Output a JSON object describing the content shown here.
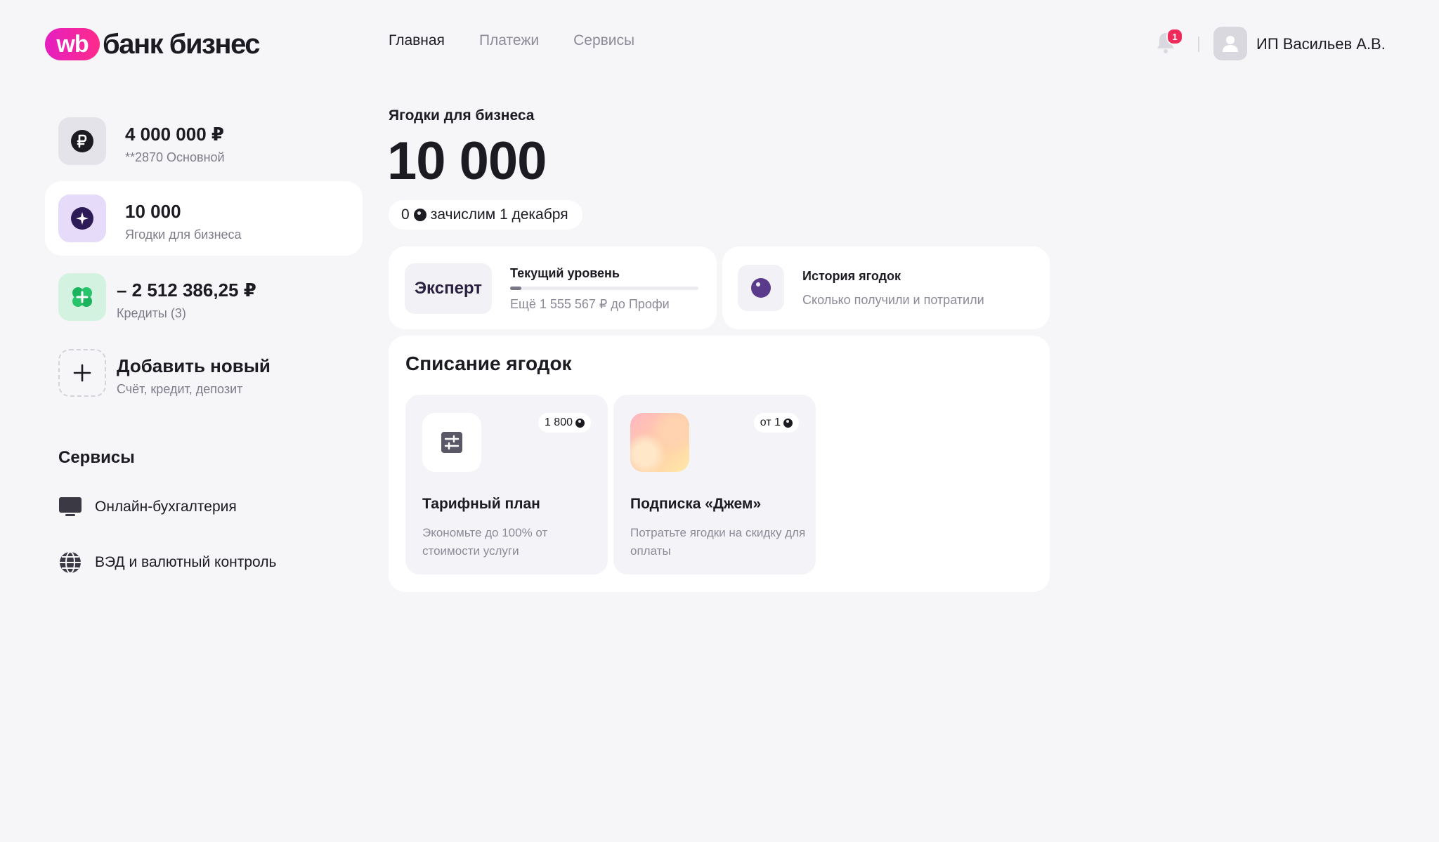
{
  "header": {
    "logo_badge": "wb",
    "logo_text": "банк бизнес",
    "nav": [
      "Главная",
      "Платежи",
      "Сервисы"
    ],
    "notifications_count": "1",
    "user_name": "ИП Васильев А.В."
  },
  "sidebar": {
    "accounts": [
      {
        "title": "4 000 000 ₽",
        "subtitle": "**2870  Основной",
        "icon": "ruble-icon"
      },
      {
        "title": "10 000",
        "subtitle": "Ягодки для бизнеса",
        "icon": "berry-icon"
      },
      {
        "title": "– 2 512 386,25 ₽",
        "subtitle": "Кредиты (3)",
        "icon": "credit-icon"
      },
      {
        "title": "Добавить новый",
        "subtitle": "Счёт, кредит, депозит",
        "icon": "plus-icon"
      }
    ],
    "services_title": "Сервисы",
    "services": [
      {
        "label": "Онлайн-бухгалтерия",
        "icon": "monitor-icon"
      },
      {
        "label": "ВЭД и валютный контроль",
        "icon": "globe-icon"
      }
    ]
  },
  "main": {
    "label": "Ягодки для бизнеса",
    "balance": "10 000",
    "pending_amount": "0",
    "pending_text": "зачислим 1 декабря",
    "level": {
      "badge": "Эксперт",
      "title": "Текущий уровень",
      "progress_percent": 6,
      "subtitle": "Ещё 1 555 567 ₽ до Профи"
    },
    "history": {
      "title": "История ягодок",
      "subtitle": "Сколько получили и потратили"
    },
    "spend": {
      "title": "Списание ягодок",
      "tiles": [
        {
          "title": "Тарифный план",
          "price": "1 800",
          "desc": "Экономьте до 100% от стоимости услуги",
          "icon": "sliders-icon"
        },
        {
          "title": "Подписка «Джем»",
          "price": "от 1",
          "desc": "Потратьте ягодки на скидку для оплаты",
          "icon": "gradient-icon"
        }
      ]
    }
  },
  "colors": {
    "background": "#f6f6f9",
    "brand_gradient_start": "#e41fc1",
    "brand_gradient_end": "#ff2b8a",
    "notification": "#ef2a5b",
    "berry_tile": "#e6dcfa",
    "credit_tile": "#d3f3e0"
  }
}
